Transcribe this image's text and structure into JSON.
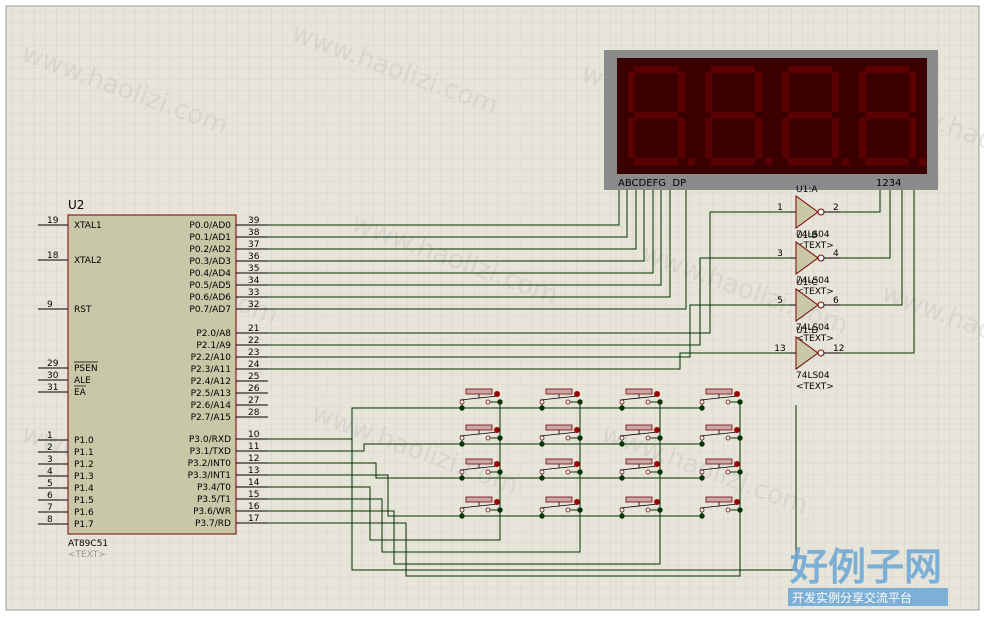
{
  "colors": {
    "grid_bg": "#e7e5d9",
    "grid_line": "#c9c8bb",
    "wire": "#003300",
    "chip_fill": "#c8c8a8",
    "chip_border": "#7a0000",
    "display_bg": "#8b8b8b",
    "segment_off": "#5a0000",
    "button_dot": "#990000"
  },
  "mcu": {
    "ref": "U2",
    "part": "AT89C51",
    "text_placeholder": "<TEXT>",
    "left_pins": [
      {
        "num": "19",
        "name": "XTAL1"
      },
      {
        "num": "18",
        "name": "XTAL2"
      },
      {
        "num": "9",
        "name": "RST"
      },
      {
        "num": "29",
        "name": "PSEN"
      },
      {
        "num": "30",
        "name": "ALE"
      },
      {
        "num": "31",
        "name": "EA"
      },
      {
        "num": "1",
        "name": "P1.0"
      },
      {
        "num": "2",
        "name": "P1.1"
      },
      {
        "num": "3",
        "name": "P1.2"
      },
      {
        "num": "4",
        "name": "P1.3"
      },
      {
        "num": "5",
        "name": "P1.4"
      },
      {
        "num": "6",
        "name": "P1.5"
      },
      {
        "num": "7",
        "name": "P1.6"
      },
      {
        "num": "8",
        "name": "P1.7"
      }
    ],
    "right_pins": [
      {
        "num": "39",
        "name": "P0.0/AD0"
      },
      {
        "num": "38",
        "name": "P0.1/AD1"
      },
      {
        "num": "37",
        "name": "P0.2/AD2"
      },
      {
        "num": "36",
        "name": "P0.3/AD3"
      },
      {
        "num": "35",
        "name": "P0.4/AD4"
      },
      {
        "num": "34",
        "name": "P0.5/AD5"
      },
      {
        "num": "33",
        "name": "P0.6/AD6"
      },
      {
        "num": "32",
        "name": "P0.7/AD7"
      },
      {
        "num": "21",
        "name": "P2.0/A8"
      },
      {
        "num": "22",
        "name": "P2.1/A9"
      },
      {
        "num": "23",
        "name": "P2.2/A10"
      },
      {
        "num": "24",
        "name": "P2.3/A11"
      },
      {
        "num": "25",
        "name": "P2.4/A12"
      },
      {
        "num": "26",
        "name": "P2.5/A13"
      },
      {
        "num": "27",
        "name": "P2.6/A14"
      },
      {
        "num": "28",
        "name": "P2.7/A15"
      },
      {
        "num": "10",
        "name": "P3.0/RXD"
      },
      {
        "num": "11",
        "name": "P3.1/TXD"
      },
      {
        "num": "12",
        "name": "P3.2/INT0"
      },
      {
        "num": "13",
        "name": "P3.3/INT1"
      },
      {
        "num": "14",
        "name": "P3.4/T0"
      },
      {
        "num": "15",
        "name": "P3.5/T1"
      },
      {
        "num": "16",
        "name": "P3.6/WR"
      },
      {
        "num": "17",
        "name": "P3.7/RD"
      }
    ]
  },
  "display": {
    "segments_label": "ABCDEFG  DP",
    "digits_label": "1234",
    "digit_count": 4
  },
  "inverters": [
    {
      "ref": "U1:A",
      "part": "74LS04",
      "text": "<TEXT>",
      "in_pin": "1",
      "out_pin": "2"
    },
    {
      "ref": "U1:B",
      "part": "74LS04",
      "text": "<TEXT>",
      "in_pin": "3",
      "out_pin": "4"
    },
    {
      "ref": "U1:C",
      "part": "74LS04",
      "text": "<TEXT>",
      "in_pin": "5",
      "out_pin": "6"
    },
    {
      "ref": "U1:D",
      "part": "74LS04",
      "text": "<TEXT>",
      "in_pin": "13",
      "out_pin": "12"
    }
  ],
  "keypad": {
    "rows": 4,
    "cols": 4
  },
  "watermark": {
    "text": "www.haolizi.com",
    "logo_title": "好例子网",
    "logo_subtitle": "开发实例分享交流平台"
  }
}
